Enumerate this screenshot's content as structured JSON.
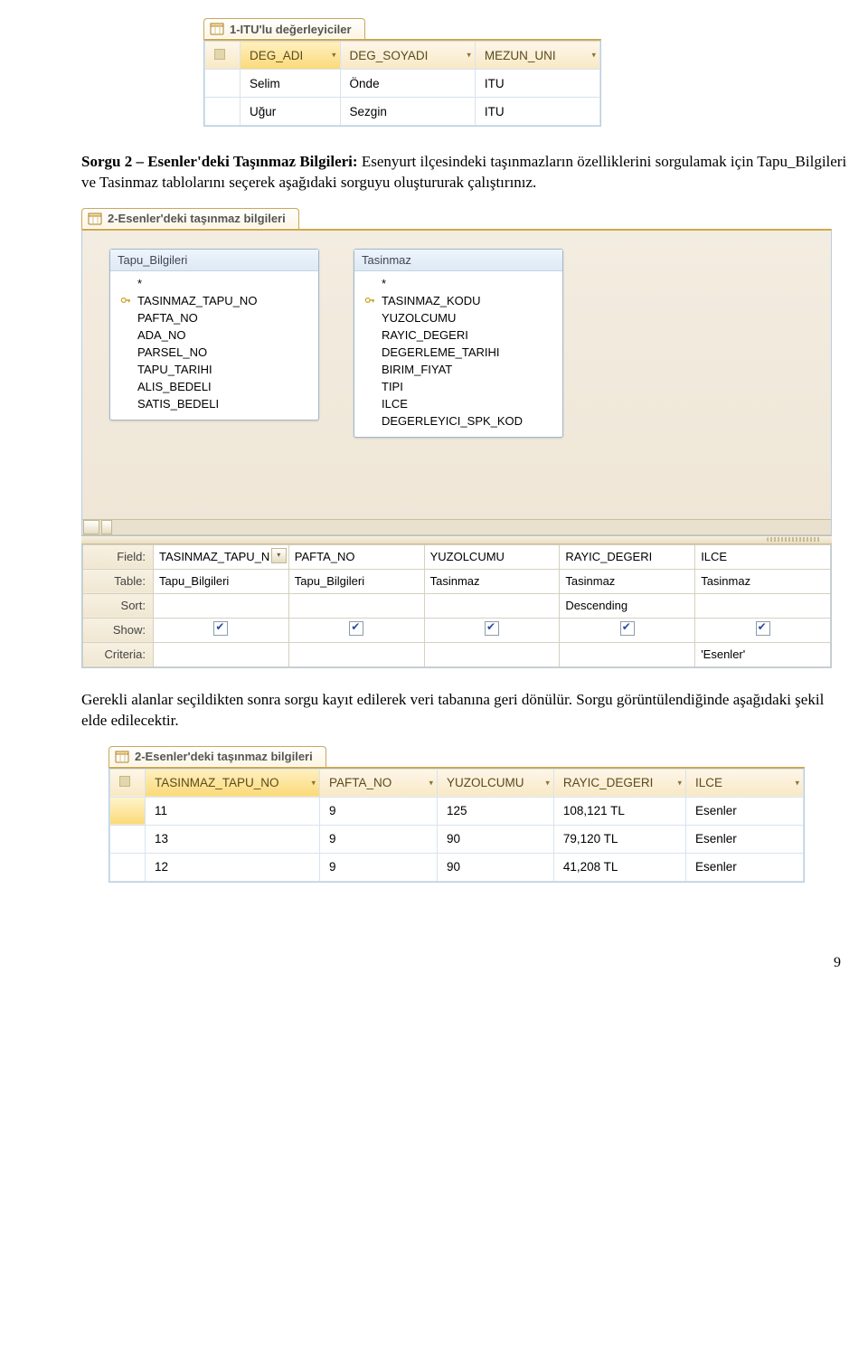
{
  "top_grid": {
    "tab_title": "1-ITU'lu değerleyiciler",
    "columns": [
      "DEG_ADI",
      "DEG_SOYADI",
      "MEZUN_UNI"
    ],
    "rows": [
      [
        "Selim",
        "Önde",
        "ITU"
      ],
      [
        "Uğur",
        "Sezgin",
        "ITU"
      ]
    ]
  },
  "para1": {
    "heading": "Sorgu 2 – Esenler'deki Taşınmaz Bilgileri: ",
    "body": "Esenyurt ilçesindeki taşınmazların özelliklerini sorgulamak için Tapu_Bilgileri ve Tasinmaz tablolarını seçerek aşağıdaki sorguyu oluştururak çalıştırınız."
  },
  "design": {
    "tab_title": "2-Esenler'deki taşınmaz bilgileri",
    "tables": [
      {
        "name": "Tapu_Bilgileri",
        "fields": [
          {
            "label": "*",
            "key": false
          },
          {
            "label": "TASINMAZ_TAPU_NO",
            "key": true
          },
          {
            "label": "PAFTA_NO",
            "key": false
          },
          {
            "label": "ADA_NO",
            "key": false
          },
          {
            "label": "PARSEL_NO",
            "key": false
          },
          {
            "label": "TAPU_TARIHI",
            "key": false
          },
          {
            "label": "ALIS_BEDELI",
            "key": false
          },
          {
            "label": "SATIS_BEDELI",
            "key": false
          }
        ]
      },
      {
        "name": "Tasinmaz",
        "fields": [
          {
            "label": "*",
            "key": false
          },
          {
            "label": "TASINMAZ_KODU",
            "key": true
          },
          {
            "label": "YUZOLCUMU",
            "key": false
          },
          {
            "label": "RAYIC_DEGERI",
            "key": false
          },
          {
            "label": "DEGERLEME_TARIHI",
            "key": false
          },
          {
            "label": "BIRIM_FIYAT",
            "key": false
          },
          {
            "label": "TIPI",
            "key": false
          },
          {
            "label": "ILCE",
            "key": false
          },
          {
            "label": "DEGERLEYICI_SPK_KOD",
            "key": false
          }
        ]
      }
    ],
    "qbe": {
      "labels": {
        "field": "Field:",
        "table": "Table:",
        "sort": "Sort:",
        "show": "Show:",
        "criteria": "Criteria:"
      },
      "cols": [
        {
          "field": "TASINMAZ_TAPU_N",
          "table": "Tapu_Bilgileri",
          "sort": "",
          "show": true,
          "criteria": "",
          "dd": true
        },
        {
          "field": "PAFTA_NO",
          "table": "Tapu_Bilgileri",
          "sort": "",
          "show": true,
          "criteria": ""
        },
        {
          "field": "YUZOLCUMU",
          "table": "Tasinmaz",
          "sort": "",
          "show": true,
          "criteria": ""
        },
        {
          "field": "RAYIC_DEGERI",
          "table": "Tasinmaz",
          "sort": "Descending",
          "show": true,
          "criteria": ""
        },
        {
          "field": "ILCE",
          "table": "Tasinmaz",
          "sort": "",
          "show": true,
          "criteria": "'Esenler'"
        }
      ]
    }
  },
  "para2": "Gerekli alanlar seçildikten sonra sorgu kayıt edilerek veri tabanına geri dönülür. Sorgu görüntülendiğinde aşağıdaki şekil elde edilecektir.",
  "result_grid": {
    "tab_title": "2-Esenler'deki taşınmaz bilgileri",
    "columns": [
      "TASINMAZ_TAPU_NO",
      "PAFTA_NO",
      "YUZOLCUMU",
      "RAYIC_DEGERI",
      "ILCE"
    ],
    "rows": [
      [
        "11",
        "9",
        "125",
        "108,121 TL",
        "Esenler"
      ],
      [
        "13",
        "9",
        "90",
        "79,120 TL",
        "Esenler"
      ],
      [
        "12",
        "9",
        "90",
        "41,208 TL",
        "Esenler"
      ]
    ]
  },
  "page_number": "9"
}
